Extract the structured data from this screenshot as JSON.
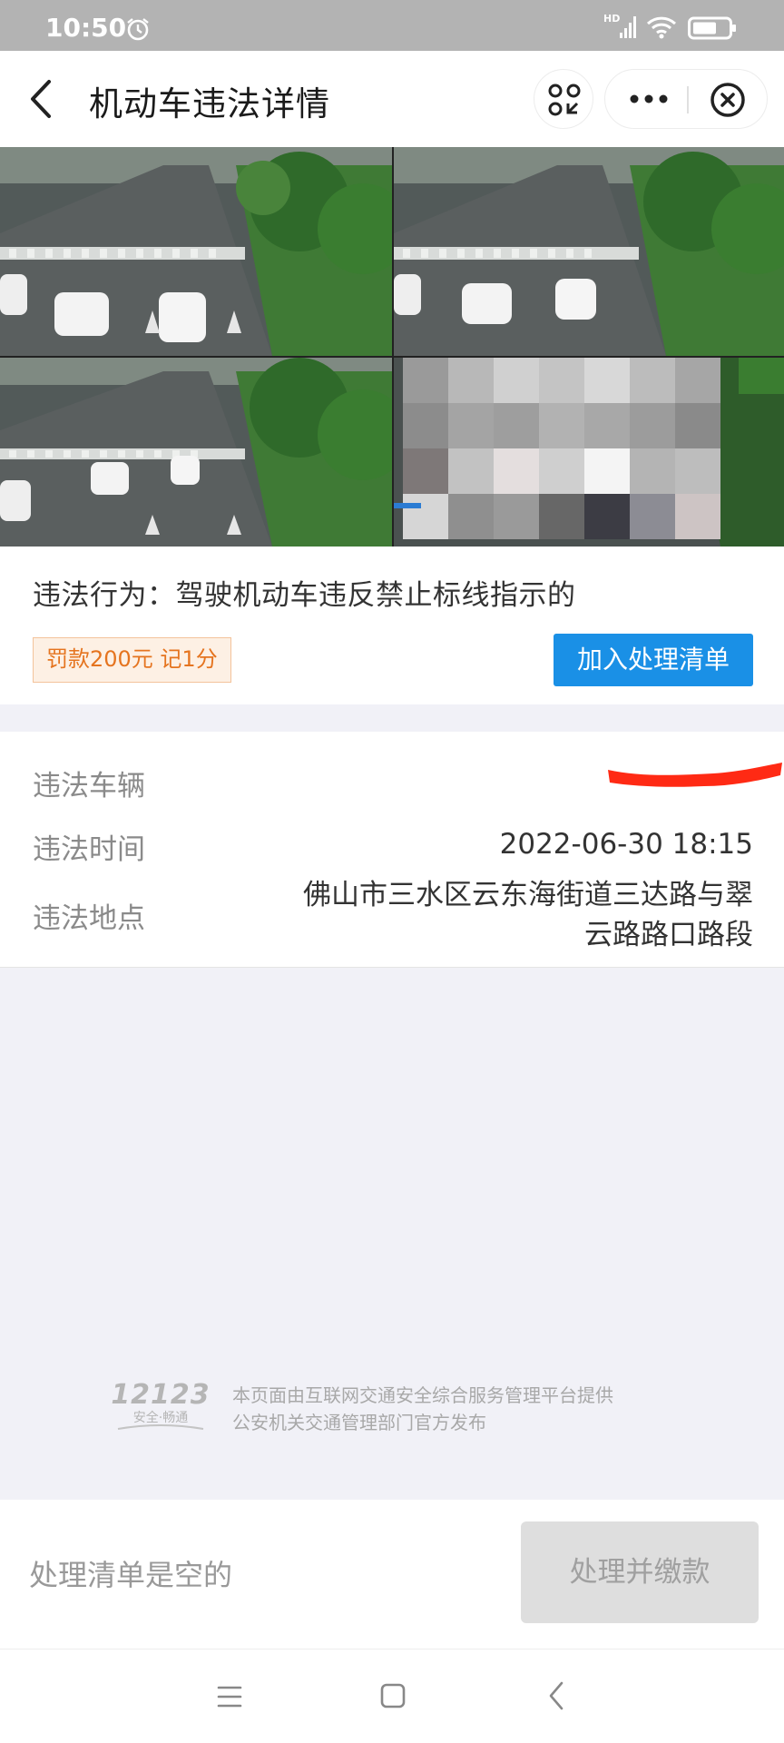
{
  "status_bar": {
    "time": "10:50",
    "network_badge": "HD"
  },
  "header": {
    "title": "机动车违法详情"
  },
  "violation": {
    "behavior": "违法行为：驾驶机动车违反禁止标线指示的",
    "penalty": "罚款200元 记1分",
    "add_to_list_button": "加入处理清单"
  },
  "details": {
    "vehicle_label": "违法车辆",
    "time_label": "违法时间",
    "time_value": "2022-06-30 18:15",
    "location_label": "违法地点",
    "location_line1": "佛山市三水区云东海街道三达路与翠",
    "location_line2": "云路路口路段"
  },
  "footer": {
    "logo_number": "12123",
    "logo_slogan": "安全·畅通",
    "line1": "本页面由互联网交通安全综合服务管理平台提供",
    "line2": "公安机关交通管理部门官方发布"
  },
  "bottom_bar": {
    "empty_text": "处理清单是空的",
    "pay_button": "处理并缴款"
  },
  "colors": {
    "accent": "#1a90e6",
    "penalty": "#e5741f",
    "redaction": "#ff2a14"
  }
}
